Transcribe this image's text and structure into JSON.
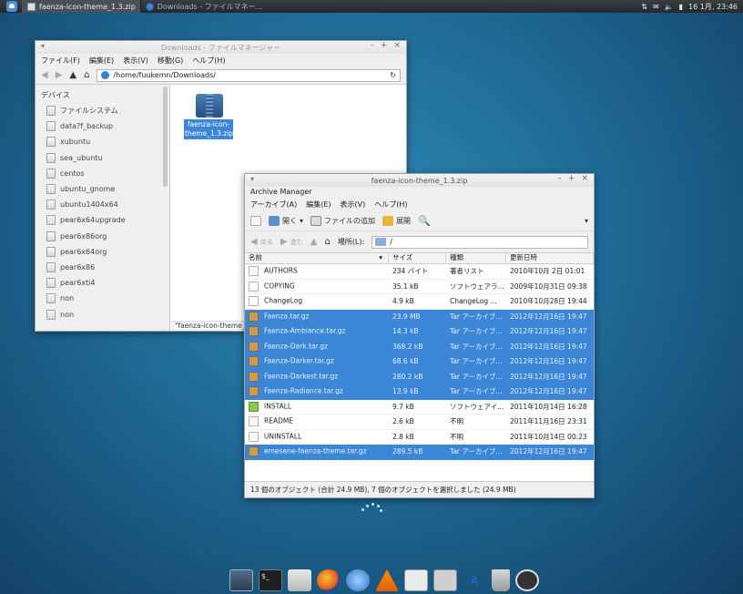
{
  "top_panel": {
    "tasks": [
      {
        "label": "faenza-icon-theme_1.3.zip",
        "active": true
      },
      {
        "label": "Downloads - ファイルマネー...",
        "active": false
      }
    ],
    "clock": "16 1月, 23:46"
  },
  "thunar": {
    "title": "Downloads - ファイルマネージャー",
    "menu": [
      "ファイル(F)",
      "編集(E)",
      "表示(V)",
      "移動(G)",
      "ヘルプ(H)"
    ],
    "path": "/home/fuukemn/Downloads/",
    "sidebar_header": "デバイス",
    "devices": [
      "ファイルシステム",
      "data?f_backup",
      "xubuntu",
      "sea_ubuntu",
      "centos",
      "ubuntu_gnome",
      "ubuntu1404x64",
      "pear6x64upgrade",
      "pear6x86org",
      "pear6x64org",
      "pear6x86",
      "pear6xti4",
      "non",
      "non"
    ],
    "file": {
      "name": "faenza-icon-theme_1.3.zip"
    },
    "status": "\"faenza-icon-theme_1.3.zip\" Zip"
  },
  "archive": {
    "title": "faenza-icon-theme_1.3.zip",
    "app_name": "Archive Manager",
    "menu": [
      "アーカイブ(A)",
      "編集(E)",
      "表示(V)",
      "ヘルプ(H)"
    ],
    "toolbar": {
      "open": "開く",
      "add": "ファイルの追加",
      "extract": "展開"
    },
    "nav": {
      "back": "戻る",
      "forward": "進む",
      "up": "上へ",
      "home": "ホーム"
    },
    "location_label": "場所(L):",
    "location_value": "/",
    "columns": [
      "名前",
      "サイズ",
      "種類",
      "更新日時"
    ],
    "files": [
      {
        "name": "AUTHORS",
        "size": "234 バイト",
        "type": "著者リスト",
        "date": "2010年10月 2日 01:01",
        "icon": "text",
        "selected": false
      },
      {
        "name": "COPYING",
        "size": "35.1 kB",
        "type": "ソフトウェアラ...",
        "date": "2009年10月31日 09:38",
        "icon": "text",
        "selected": false
      },
      {
        "name": "ChangeLog",
        "size": "4.9 kB",
        "type": "ChangeLog ...",
        "date": "2010年10月28日 19:44",
        "icon": "text",
        "selected": false
      },
      {
        "name": "Faenza.tar.gz",
        "size": "23.9 MB",
        "type": "Tar アーカイブ...",
        "date": "2012年12月16日 19:47",
        "icon": "tgz",
        "selected": true
      },
      {
        "name": "Faenza-Ambiance.tar.gz",
        "size": "14.3 kB",
        "type": "Tar アーカイブ...",
        "date": "2012年12月16日 19:47",
        "icon": "tgz",
        "selected": true
      },
      {
        "name": "Faenza-Dark.tar.gz",
        "size": "368.2 kB",
        "type": "Tar アーカイブ...",
        "date": "2012年12月16日 19:47",
        "icon": "tgz",
        "selected": true
      },
      {
        "name": "Faenza-Darker.tar.gz",
        "size": "68.6 kB",
        "type": "Tar アーカイブ...",
        "date": "2012年12月16日 19:47",
        "icon": "tgz",
        "selected": true
      },
      {
        "name": "Faenza-Darkest.tar.gz",
        "size": "280.2 kB",
        "type": "Tar アーカイブ...",
        "date": "2012年12月16日 19:47",
        "icon": "tgz",
        "selected": true
      },
      {
        "name": "Faenza-Radiance.tar.gz",
        "size": "13.9 kB",
        "type": "Tar アーカイブ...",
        "date": "2012年12月16日 19:47",
        "icon": "tgz",
        "selected": true
      },
      {
        "name": "INSTALL",
        "size": "9.7 kB",
        "type": "ソフトウェアイ...",
        "date": "2011年10月14日 16:28",
        "icon": "exec",
        "selected": false
      },
      {
        "name": "README",
        "size": "2.6 kB",
        "type": "不明",
        "date": "2011年11月16日 23:31",
        "icon": "text",
        "selected": false
      },
      {
        "name": "UNINSTALL",
        "size": "2.8 kB",
        "type": "不明",
        "date": "2011年10月14日 00:23",
        "icon": "text",
        "selected": false
      },
      {
        "name": "emesene-faenza-theme.tar.gz",
        "size": "289.5 kB",
        "type": "Tar アーカイブ...",
        "date": "2012年12月16日 19:47",
        "icon": "tgz",
        "selected": true
      }
    ],
    "status": "13 個のオブジェクト (合計 24.9 MB), 7 個のオブジェクトを選択しました (24.9 MB)"
  },
  "dock": {
    "items": [
      "desktop",
      "terminal",
      "file-manager",
      "firefox",
      "network",
      "vlc",
      "calendar",
      "camera",
      "text-editor",
      "trash",
      "power"
    ]
  },
  "colors": {
    "selection": "#3b86d7",
    "desktop": "#1f6b96",
    "panel": "#2e3236"
  }
}
